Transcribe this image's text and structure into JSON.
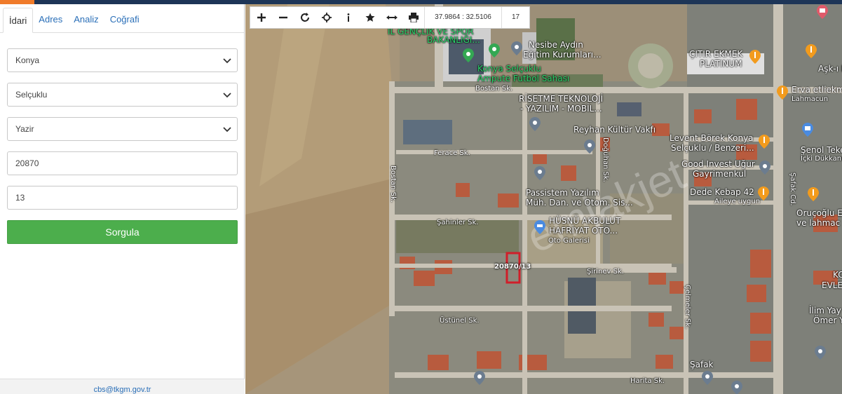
{
  "tabs": [
    {
      "label": "İdari",
      "active": true
    },
    {
      "label": "Adres"
    },
    {
      "label": "Analiz"
    },
    {
      "label": "Coğrafi"
    }
  ],
  "form": {
    "province": "Konya",
    "district": "Selçuklu",
    "neighborhood": "Yazir",
    "block": "20870",
    "parcel": "13",
    "query_label": "Sorgula"
  },
  "footer": {
    "email": "cbs@tkgm.gov.tr"
  },
  "toolbar": {
    "coordinates": "37.9864 : 32.5106",
    "zoom_level": "17"
  },
  "map": {
    "watermark": "emlakjet",
    "parcel_label": "20870/13",
    "places": {
      "genclik": "İL GENÇLİK VE SPOR",
      "bakanligi": "BAKANLIĞI...",
      "nesibe1": "Nesibe Aydın",
      "nesibe2": "Eğitim Kurumları...",
      "konya_sel1": "Konya Selçuklu",
      "konya_sel2": "Ampute Futbol Sahası",
      "citir1": "ÇITIR EKMEK",
      "citir2": "PLATINUM",
      "askidem": "Aşk-ı Dem",
      "erva1": "Erva etliekm",
      "erva2": "Lahmacun",
      "riset1": "RİSETME TEKNOLOJİ",
      "riset2": "- YAZILIM - MOBİL...",
      "reyhan": "Reyhan Kültür Vakfı",
      "levent1": "Levent Börek Konya",
      "levent2": "Selçuklu / Benzeri...",
      "senol1": "Şenol Tekel",
      "senol2": "İçki Dükkanı",
      "good1": "Good Invest Uğur",
      "good2": "Gayrimenkul",
      "dede1": "Dede Kebap 42",
      "dede2": "Aileye uygun",
      "passistem1": "Passistem Yazılım",
      "passistem2": "Müh. Dan. ve Otom. Sis...",
      "orucoglu1": "Oruçoğlu Et",
      "orucoglu2": "ve lahmac",
      "husnu1": "HÜSNÜ AKBULUT",
      "husnu2": "HAFRİYAT OTO...",
      "husnu3": "Oto Galerisi",
      "ko1": "KO",
      "ko2": "EVLE",
      "ilim1": "İlim Yay",
      "ilim2": "Ömer Ya"
    },
    "streets": {
      "bostan_top": "Bostan Sk.",
      "bostan_vert": "Bostan Sk.",
      "ferace": "Ferace Sk.",
      "doguhan": "Doğuhan Sk.",
      "sahinler": "Şahinler Sk.",
      "sirinev": "Şirinev Sk.",
      "celmeler": "Çelmeler Sk.",
      "ustunel": "Üstünel Sk.",
      "harita": "Harita Sk.",
      "safak": "Şafak",
      "safak_cd": "Şafak Cd."
    }
  }
}
